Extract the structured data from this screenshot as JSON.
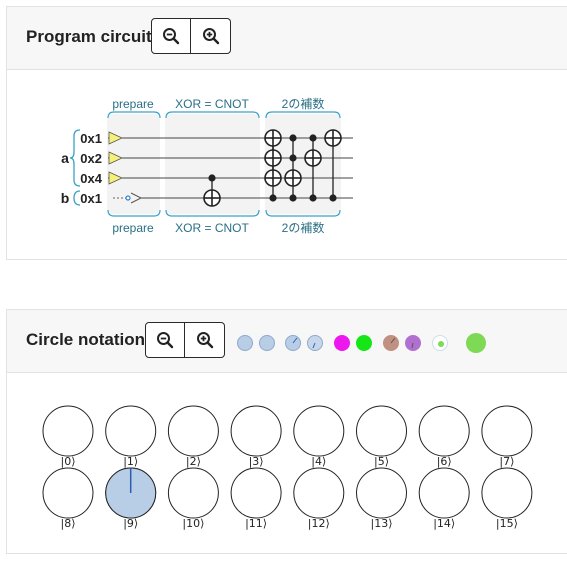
{
  "program_panel": {
    "title": "Program circuit",
    "zoom_out_icon": "zoom-out-icon",
    "zoom_in_icon": "zoom-in-icon"
  },
  "circuit": {
    "sections": [
      {
        "top_label": "prepare",
        "bottom_label": "prepare"
      },
      {
        "top_label": "XOR = CNOT",
        "bottom_label": "XOR = CNOT"
      },
      {
        "top_label": "2の補数",
        "bottom_label": "2の補数"
      }
    ],
    "registers": [
      {
        "name": "a",
        "qubits": [
          "0x1",
          "0x2",
          "0x4"
        ]
      },
      {
        "name": "b",
        "qubits": [
          "0x1"
        ]
      }
    ]
  },
  "circle_panel": {
    "title": "Circle notation",
    "zoom_out_icon": "zoom-out-icon",
    "zoom_in_icon": "zoom-in-icon",
    "colors": {
      "amplitude_fill": "#b8cde6",
      "phase_line": "#2a5fb0",
      "magenta": "#ee18ee",
      "green": "#16e616",
      "brown": "#c09080",
      "violet": "#b070d0",
      "lime": "#7ed957"
    }
  },
  "states": [
    {
      "label": "|0⟩",
      "magnitude": 0
    },
    {
      "label": "|1⟩",
      "magnitude": 0
    },
    {
      "label": "|2⟩",
      "magnitude": 0
    },
    {
      "label": "|3⟩",
      "magnitude": 0
    },
    {
      "label": "|4⟩",
      "magnitude": 0
    },
    {
      "label": "|5⟩",
      "magnitude": 0
    },
    {
      "label": "|6⟩",
      "magnitude": 0
    },
    {
      "label": "|7⟩",
      "magnitude": 0
    },
    {
      "label": "|8⟩",
      "magnitude": 0
    },
    {
      "label": "|9⟩",
      "magnitude": 1,
      "phase_deg": 0
    },
    {
      "label": "|10⟩",
      "magnitude": 0
    },
    {
      "label": "|11⟩",
      "magnitude": 0
    },
    {
      "label": "|12⟩",
      "magnitude": 0
    },
    {
      "label": "|13⟩",
      "magnitude": 0
    },
    {
      "label": "|14⟩",
      "magnitude": 0
    },
    {
      "label": "|15⟩",
      "magnitude": 0
    }
  ]
}
